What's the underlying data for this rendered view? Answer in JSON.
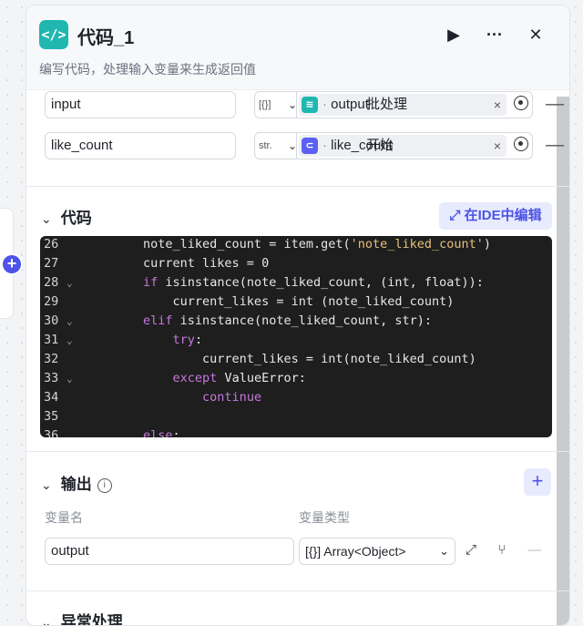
{
  "node": {
    "title": "代码_1",
    "description": "编写代码，处理输入变量来生成返回值",
    "icon_text": "</>"
  },
  "header_actions": {
    "run": "▶",
    "more": "···",
    "close": "✕"
  },
  "inputs": [
    {
      "name": "input",
      "type_short": "[{}]",
      "source_node": "批处理",
      "variable": "output",
      "source_icon": "layers-icon",
      "icon_color": "#1fb7b0"
    },
    {
      "name": "like_count",
      "type_short": "str.",
      "source_node": "开始",
      "variable": "like_count",
      "source_icon": "start-icon",
      "icon_color": "#5b5ff5"
    }
  ],
  "code_section": {
    "title": "代码",
    "ide_button": "在IDE中编辑",
    "lines": [
      {
        "n": "26",
        "fold": "",
        "indent": "        ",
        "html": "note_liked_count = item.get(<span class=\"str\">'note_liked_count'</span>)"
      },
      {
        "n": "27",
        "fold": "",
        "indent": "        ",
        "html": "current likes = 0"
      },
      {
        "n": "28",
        "fold": "⌄",
        "indent": "        ",
        "html": "<span class=\"kw\">if</span> isinstance(note_liked_count, (int, float)):"
      },
      {
        "n": "29",
        "fold": "",
        "indent": "            ",
        "html": "current_likes = int (note_liked_count)"
      },
      {
        "n": "30",
        "fold": "⌄",
        "indent": "        ",
        "html": "<span class=\"kw\">elif</span> isinstance(note_liked_count, str):"
      },
      {
        "n": "31",
        "fold": "⌄",
        "indent": "            ",
        "html": "<span class=\"kw\">try</span>:"
      },
      {
        "n": "32",
        "fold": "",
        "indent": "                ",
        "html": "current_likes = int(note_liked_count)"
      },
      {
        "n": "33",
        "fold": "⌄",
        "indent": "            ",
        "html": "<span class=\"kw\">except</span> ValueError:"
      },
      {
        "n": "34",
        "fold": "",
        "indent": "                ",
        "html": "<span class=\"kw\">continue</span>"
      },
      {
        "n": "35",
        "fold": "",
        "indent": "",
        "html": ""
      },
      {
        "n": "36",
        "fold": "⌄",
        "indent": "        ",
        "html": "<span class=\"kw\">else</span>:"
      }
    ]
  },
  "output_section": {
    "title": "输出",
    "col_name": "变量名",
    "col_type": "变量类型",
    "row": {
      "name": "output",
      "type": "Array<Object>",
      "type_icon": "[{}]"
    }
  },
  "next_section": {
    "title": "异常处理"
  }
}
